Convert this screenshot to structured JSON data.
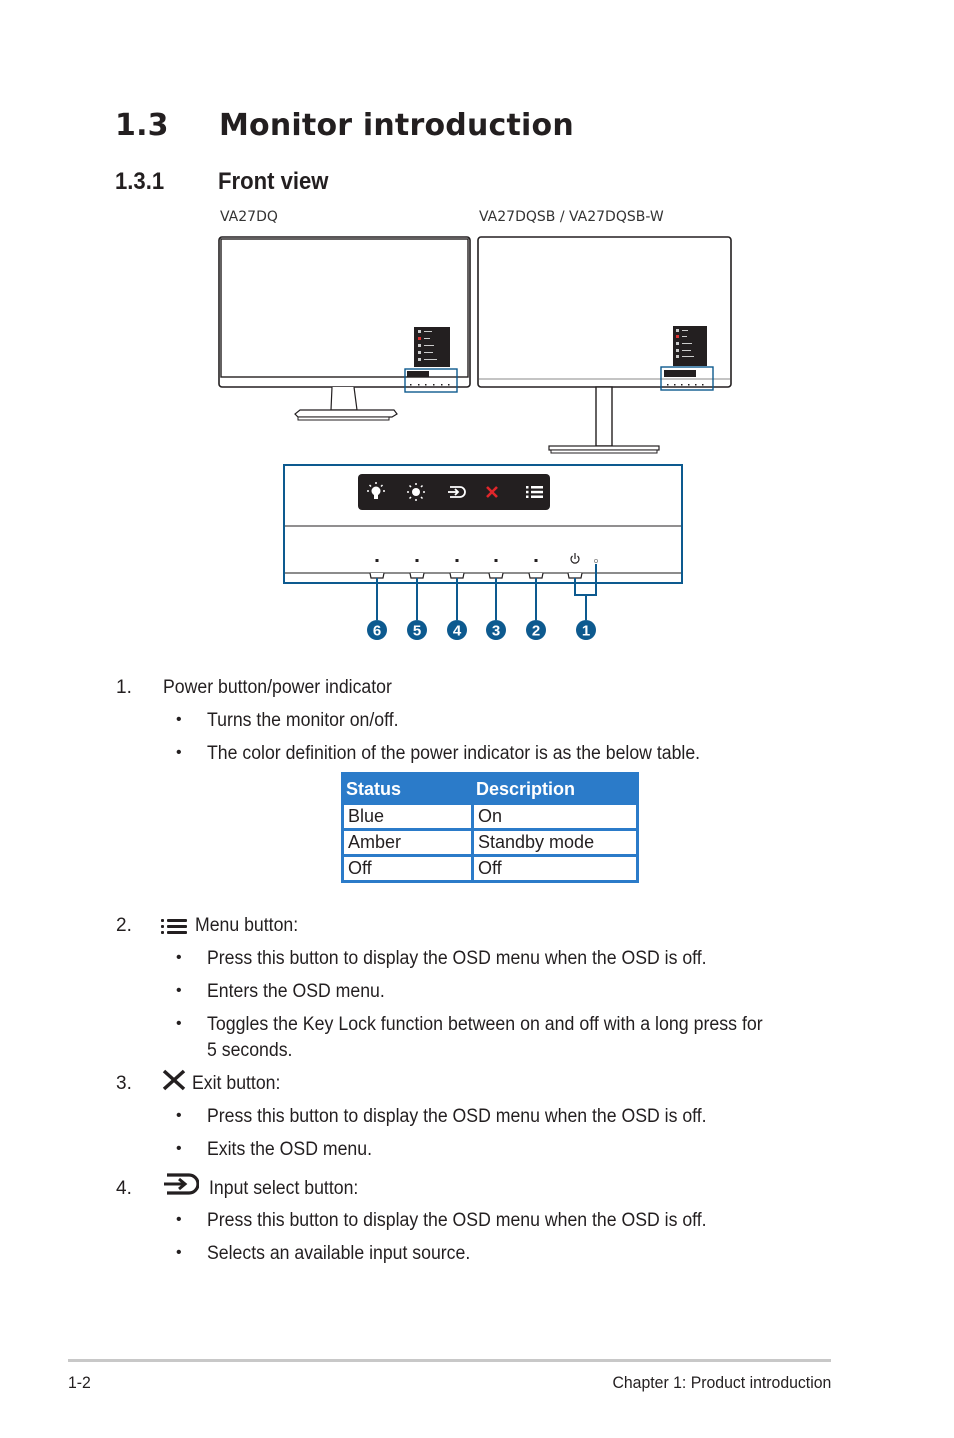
{
  "section": {
    "number": "1.3",
    "title": "Monitor introduction"
  },
  "subsection": {
    "number": "1.3.1",
    "title": "Front view"
  },
  "figure": {
    "model_left": "VA27DQ",
    "model_right": "VA27DQSB / VA27DQSB-W",
    "osd_keys": [
      "light-bulb-icon",
      "brightness-icon",
      "input-icon",
      "close-icon",
      "menu-icon"
    ],
    "callouts": [
      "6",
      "5",
      "4",
      "3",
      "2",
      "1"
    ],
    "colors": {
      "callout_blue": "#0d5a8f",
      "osd_bg": "#231f20",
      "exit_red": "#e0262b"
    }
  },
  "items": [
    {
      "number": "1.",
      "icon": "",
      "label": "Power button/power indicator",
      "bullets": [
        "Turns the monitor on/off.",
        "The color definition of the power indicator is as the below table."
      ]
    },
    {
      "number": "2.",
      "icon": "menu-icon",
      "label": "Menu button:",
      "bullets": [
        "Press this button to display the OSD menu when the OSD is off.",
        "Enters the OSD menu.",
        "Toggles the Key Lock function between on and off with a long press for",
        "5 seconds."
      ]
    },
    {
      "number": "3.",
      "icon": "close-icon",
      "label": "Exit button:",
      "bullets": [
        "Press this button to display the OSD menu when the OSD is off.",
        "Exits the OSD menu."
      ]
    },
    {
      "number": "4.",
      "icon": "input-icon",
      "label": "Input select button:",
      "bullets": [
        "Press this button to display the OSD menu when the OSD is off.",
        "Selects an available input source."
      ]
    }
  ],
  "indicator_table": {
    "headers": [
      "Status",
      "Description"
    ],
    "rows": [
      [
        "Blue",
        "On"
      ],
      [
        "Amber",
        "Standby mode"
      ],
      [
        "Off",
        "Off"
      ]
    ],
    "header_color": "#2b7bc9"
  },
  "footer": {
    "page": "1-2",
    "chapter": "Chapter 1: Product introduction"
  }
}
